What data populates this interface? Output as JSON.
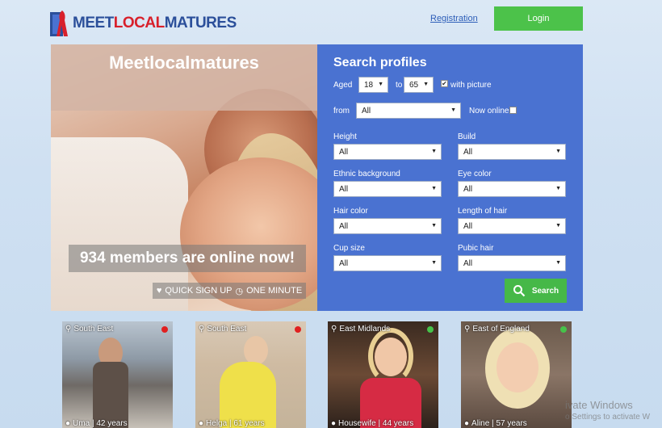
{
  "header": {
    "logo": {
      "part1": "MEET",
      "part2": "LOCAL",
      "part3": "MATURES"
    },
    "registration_label": "Registration",
    "login_label": "Login"
  },
  "hero": {
    "title": "Meetlocalmatures",
    "online_text": "934 members are online now!",
    "signup_text": "QUICK SIGN UP",
    "minute_text": "ONE MINUTE"
  },
  "search": {
    "title": "Search profiles",
    "aged_label": "Aged",
    "age_from": "18",
    "to_label": "to",
    "age_to": "65",
    "with_picture_label": "with picture",
    "with_picture_checked": true,
    "from_label": "from",
    "from_value": "All",
    "now_online_label": "Now online",
    "now_online_checked": false,
    "fields": [
      {
        "label": "Height",
        "value": "All"
      },
      {
        "label": "Build",
        "value": "All"
      },
      {
        "label": "Ethnic background",
        "value": "All"
      },
      {
        "label": "Eye color",
        "value": "All"
      },
      {
        "label": "Hair color",
        "value": "All"
      },
      {
        "label": "Length of hair",
        "value": "All"
      },
      {
        "label": "Cup size",
        "value": "All"
      },
      {
        "label": "Pubic hair",
        "value": "All"
      }
    ],
    "button_label": "Search"
  },
  "profiles": [
    {
      "region": "South East",
      "name": "Uma | 42 years",
      "status_color": "#e02020"
    },
    {
      "region": "South East",
      "name": "Helga | 61 years",
      "status_color": "#e02020"
    },
    {
      "region": "East Midlands",
      "name": "Housewife | 44 years",
      "status_color": "#46c34a"
    },
    {
      "region": "East of England",
      "name": "Aline | 57 years",
      "status_color": "#46c34a"
    }
  ],
  "os_watermark": {
    "line1": "ivate Windows",
    "line2": "o Settings to activate W"
  }
}
